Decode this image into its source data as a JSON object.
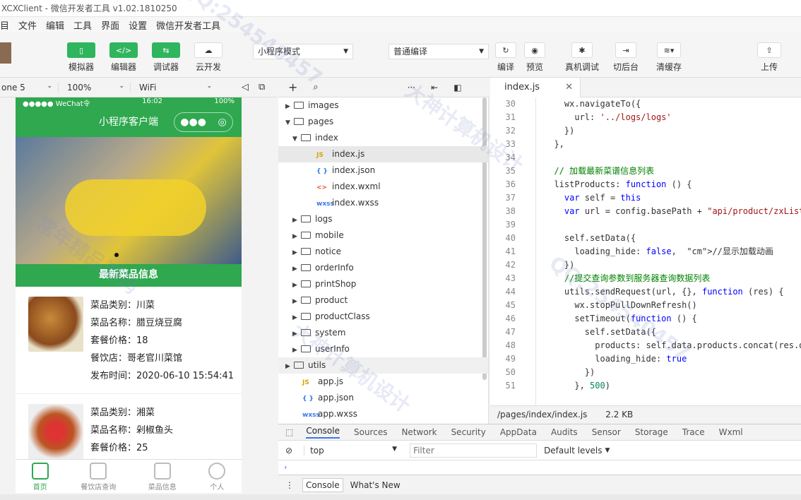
{
  "title": "XCXClient - 微信开发者工具 v1.02.1810250",
  "menu": [
    "目",
    "文件",
    "编辑",
    "工具",
    "界面",
    "设置",
    "微信开发者工具"
  ],
  "toolbar": {
    "simulator": "模拟器",
    "editor": "编辑器",
    "debugger": "调试器",
    "cloud": "云开发",
    "mode": "小程序模式",
    "compile": "普通编译",
    "rebuild": "编译",
    "preview": "预览",
    "remote_debug": "真机调试",
    "background": "切后台",
    "clear_cache": "清缓存",
    "upload": "上传"
  },
  "subbar": {
    "device": "one 5",
    "zoom": "100%",
    "network": "WiFi"
  },
  "phone": {
    "carrier": "●●●●● WeChat令",
    "time": "16:02",
    "battery": "100%",
    "nav_title": "小程序客户端",
    "section_title": "最新菜品信息",
    "dishes": [
      {
        "category": "菜品类别：川菜",
        "name": "菜品名称：腊豆烧豆腐",
        "price": "套餐价格：18",
        "shop": "餐饮店：哥老官川菜馆",
        "time": "发布时间：2020-06-10 15:54:41"
      },
      {
        "category": "菜品类别：湘菜",
        "name": "菜品名称：剁椒鱼头",
        "price": "套餐价格：25"
      }
    ],
    "tabs": [
      "首页",
      "餐饮店查询",
      "菜品信息",
      "个人"
    ]
  },
  "tree": [
    {
      "label": "images",
      "type": "folder",
      "depth": 0,
      "open": false
    },
    {
      "label": "pages",
      "type": "folder",
      "depth": 0,
      "open": true
    },
    {
      "label": "index",
      "type": "folder",
      "depth": 1,
      "open": true
    },
    {
      "label": "index.js",
      "type": "js",
      "depth": 2
    },
    {
      "label": "index.json",
      "type": "json",
      "depth": 2
    },
    {
      "label": "index.wxml",
      "type": "wxml",
      "depth": 2
    },
    {
      "label": "index.wxss",
      "type": "wxss",
      "depth": 2
    },
    {
      "label": "logs",
      "type": "folder",
      "depth": 1,
      "open": false
    },
    {
      "label": "mobile",
      "type": "folder",
      "depth": 1,
      "open": false
    },
    {
      "label": "notice",
      "type": "folder",
      "depth": 1,
      "open": false
    },
    {
      "label": "orderInfo",
      "type": "folder",
      "depth": 1,
      "open": false
    },
    {
      "label": "printShop",
      "type": "folder",
      "depth": 1,
      "open": false
    },
    {
      "label": "product",
      "type": "folder",
      "depth": 1,
      "open": false
    },
    {
      "label": "productClass",
      "type": "folder",
      "depth": 1,
      "open": false
    },
    {
      "label": "system",
      "type": "folder",
      "depth": 1,
      "open": false
    },
    {
      "label": "userInfo",
      "type": "folder",
      "depth": 1,
      "open": false
    },
    {
      "label": "utils",
      "type": "folder",
      "depth": 0,
      "open": false
    },
    {
      "label": "app.js",
      "type": "js",
      "depth": 0
    },
    {
      "label": "app.json",
      "type": "json",
      "depth": 0
    },
    {
      "label": "app.wxss",
      "type": "wxss",
      "depth": 0
    }
  ],
  "editor": {
    "tab": "index.js",
    "path": "/pages/index/index.js",
    "size": "2.2 KB",
    "lines": [
      {
        "n": "30",
        "code": "    wx.navigateTo({"
      },
      {
        "n": "31",
        "code": "      url: '../logs/logs'"
      },
      {
        "n": "32",
        "code": "    })"
      },
      {
        "n": "33",
        "code": "  },"
      },
      {
        "n": "34",
        "code": ""
      },
      {
        "n": "35",
        "code": "  // 加载最新菜谱信息列表"
      },
      {
        "n": "36",
        "code": "  listProducts: function () {"
      },
      {
        "n": "37",
        "code": "    var self = this"
      },
      {
        "n": "38",
        "code": "    var url = config.basePath + \"api/product/zxList\""
      },
      {
        "n": "39",
        "code": ""
      },
      {
        "n": "40",
        "code": "    self.setData({"
      },
      {
        "n": "41",
        "code": "      loading_hide: false,  //显示加载动画"
      },
      {
        "n": "42",
        "code": "    })"
      },
      {
        "n": "43",
        "code": "    //提交查询参数到服务器查询数据列表"
      },
      {
        "n": "44",
        "code": "    utils.sendRequest(url, {}, function (res) {"
      },
      {
        "n": "45",
        "code": "      wx.stopPullDownRefresh()"
      },
      {
        "n": "46",
        "code": "      setTimeout(function () {"
      },
      {
        "n": "47",
        "code": "        self.setData({"
      },
      {
        "n": "48",
        "code": "          products: self.data.products.concat(res.data"
      },
      {
        "n": "49",
        "code": "          loading_hide: true"
      },
      {
        "n": "50",
        "code": "        })"
      },
      {
        "n": "51",
        "code": "      }, 500)"
      }
    ]
  },
  "devtools": {
    "tabs": [
      "Console",
      "Sources",
      "Network",
      "Security",
      "AppData",
      "Audits",
      "Sensor",
      "Storage",
      "Trace",
      "Wxml"
    ],
    "context": "top",
    "filter_placeholder": "Filter",
    "levels": "Default levels",
    "drawer_tabs": [
      "Console",
      "What's New"
    ]
  },
  "watermarks": [
    "大神计算机设计",
    "QQ:254540457",
    "常年精品源码"
  ]
}
